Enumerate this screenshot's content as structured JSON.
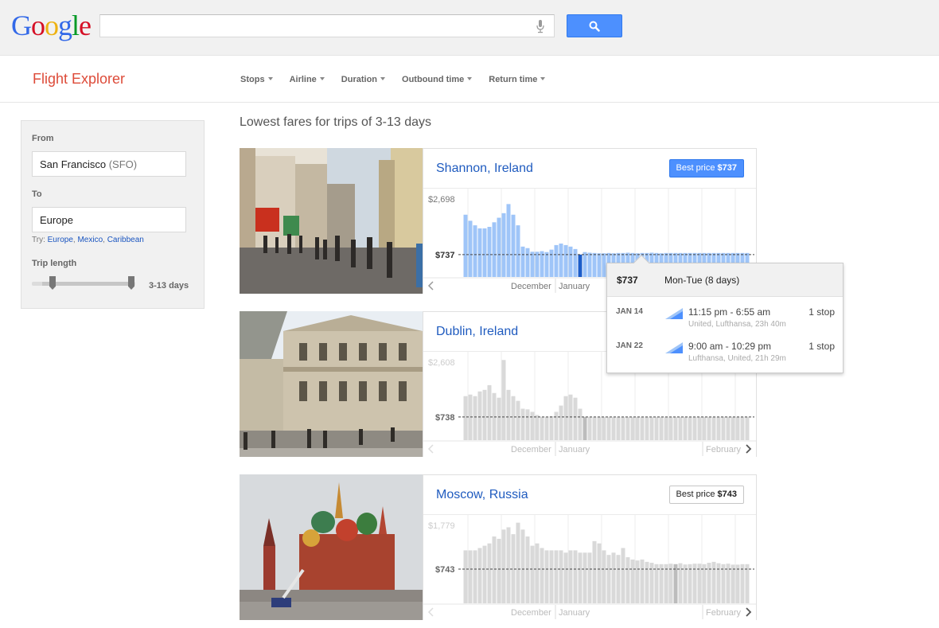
{
  "logo": "Google",
  "search": {
    "placeholder": ""
  },
  "app_title": "Flight Explorer",
  "filters": [
    "Stops",
    "Airline",
    "Duration",
    "Outbound time",
    "Return time"
  ],
  "panel": {
    "from_label": "From",
    "from_city": "San Francisco",
    "from_code": "(SFO)",
    "to_label": "To",
    "to_value": "Europe",
    "try_label": "Try:",
    "try_links": [
      "Europe",
      "Mexico",
      "Caribbean"
    ],
    "trip_length_label": "Trip length",
    "trip_length_value": "3-13 days"
  },
  "heading": "Lowest fares for trips of 3-13 days",
  "colors": {
    "accent_blue": "#4d90fe",
    "bar_blue": "#9fc5f8",
    "bar_gray": "#d9d9d9",
    "title_red": "#dd4b39",
    "link_blue": "#1f5bbf"
  },
  "destinations": [
    {
      "name": "Shannon, Ireland",
      "best_price_label": "Best price",
      "best_price": "$737",
      "highlighted": true,
      "chart_data": {
        "type": "bar",
        "max_label": "$2,698",
        "min_label": "$737",
        "ylim": [
          0,
          2698
        ],
        "min_price": 737,
        "month_labels": [
          "December",
          "January"
        ],
        "values": [
          2050,
          1850,
          1700,
          1600,
          1600,
          1650,
          1800,
          1950,
          2100,
          2400,
          2050,
          1700,
          1000,
          950,
          830,
          830,
          850,
          820,
          900,
          1050,
          1100,
          1050,
          1000,
          920,
          737,
          820,
          800,
          790,
          780,
          780,
          790,
          780,
          790,
          790,
          800,
          790,
          780,
          790,
          790,
          800,
          790,
          780,
          790,
          790,
          790,
          790,
          790,
          790,
          790,
          790,
          790,
          790,
          790,
          790,
          790,
          790,
          790,
          790,
          790,
          790
        ],
        "selected_index": 24
      }
    },
    {
      "name": "Dublin, Ireland",
      "best_price_label": "",
      "best_price": "",
      "highlighted": false,
      "chart_data": {
        "type": "bar",
        "max_label": "$2,608",
        "min_label": "$738",
        "ylim": [
          0,
          2608
        ],
        "min_price": 738,
        "month_labels": [
          "December",
          "January",
          "February"
        ],
        "values": [
          1400,
          1450,
          1400,
          1550,
          1600,
          1750,
          1500,
          1350,
          2550,
          1600,
          1400,
          1250,
          1000,
          980,
          900,
          800,
          740,
          740,
          760,
          900,
          1100,
          1400,
          1450,
          1350,
          1000,
          740,
          740,
          740,
          740,
          740,
          740,
          740,
          740,
          740,
          740,
          740,
          740,
          740,
          740,
          740,
          740,
          740,
          740,
          740,
          740,
          740,
          740,
          740,
          740,
          740,
          740,
          740,
          740,
          740,
          740,
          740,
          740,
          740,
          740,
          740
        ],
        "selected_index": 25
      }
    },
    {
      "name": "Moscow, Russia",
      "best_price_label": "Best price",
      "best_price": "$743",
      "highlighted": false,
      "chart_data": {
        "type": "bar",
        "max_label": "$1,779",
        "min_label": "$743",
        "ylim": [
          0,
          1779
        ],
        "min_price": 743,
        "month_labels": [
          "December",
          "January",
          "February"
        ],
        "values": [
          1150,
          1150,
          1150,
          1200,
          1250,
          1300,
          1450,
          1400,
          1600,
          1650,
          1500,
          1750,
          1600,
          1450,
          1250,
          1300,
          1200,
          1150,
          1150,
          1150,
          1150,
          1100,
          1150,
          1150,
          1100,
          1100,
          1100,
          1350,
          1300,
          1150,
          1050,
          1100,
          1050,
          1200,
          1000,
          950,
          930,
          950,
          900,
          880,
          850,
          850,
          850,
          860,
          850,
          870,
          843,
          850,
          860,
          860,
          850,
          880,
          900,
          870,
          850,
          860,
          840,
          840,
          850,
          850
        ],
        "selected_index": 44
      }
    }
  ],
  "tooltip": {
    "price": "$737",
    "days": "Mon-Tue (8 days)",
    "legs": [
      {
        "date": "JAN 14",
        "times": "11:15 pm - 6:55 am",
        "airline": "United, Lufthansa, 23h 40m",
        "stops": "1 stop"
      },
      {
        "date": "JAN 22",
        "times": "9:00 am - 10:29 pm",
        "airline": "Lufthansa, United, 21h 29m",
        "stops": "1 stop"
      }
    ]
  }
}
